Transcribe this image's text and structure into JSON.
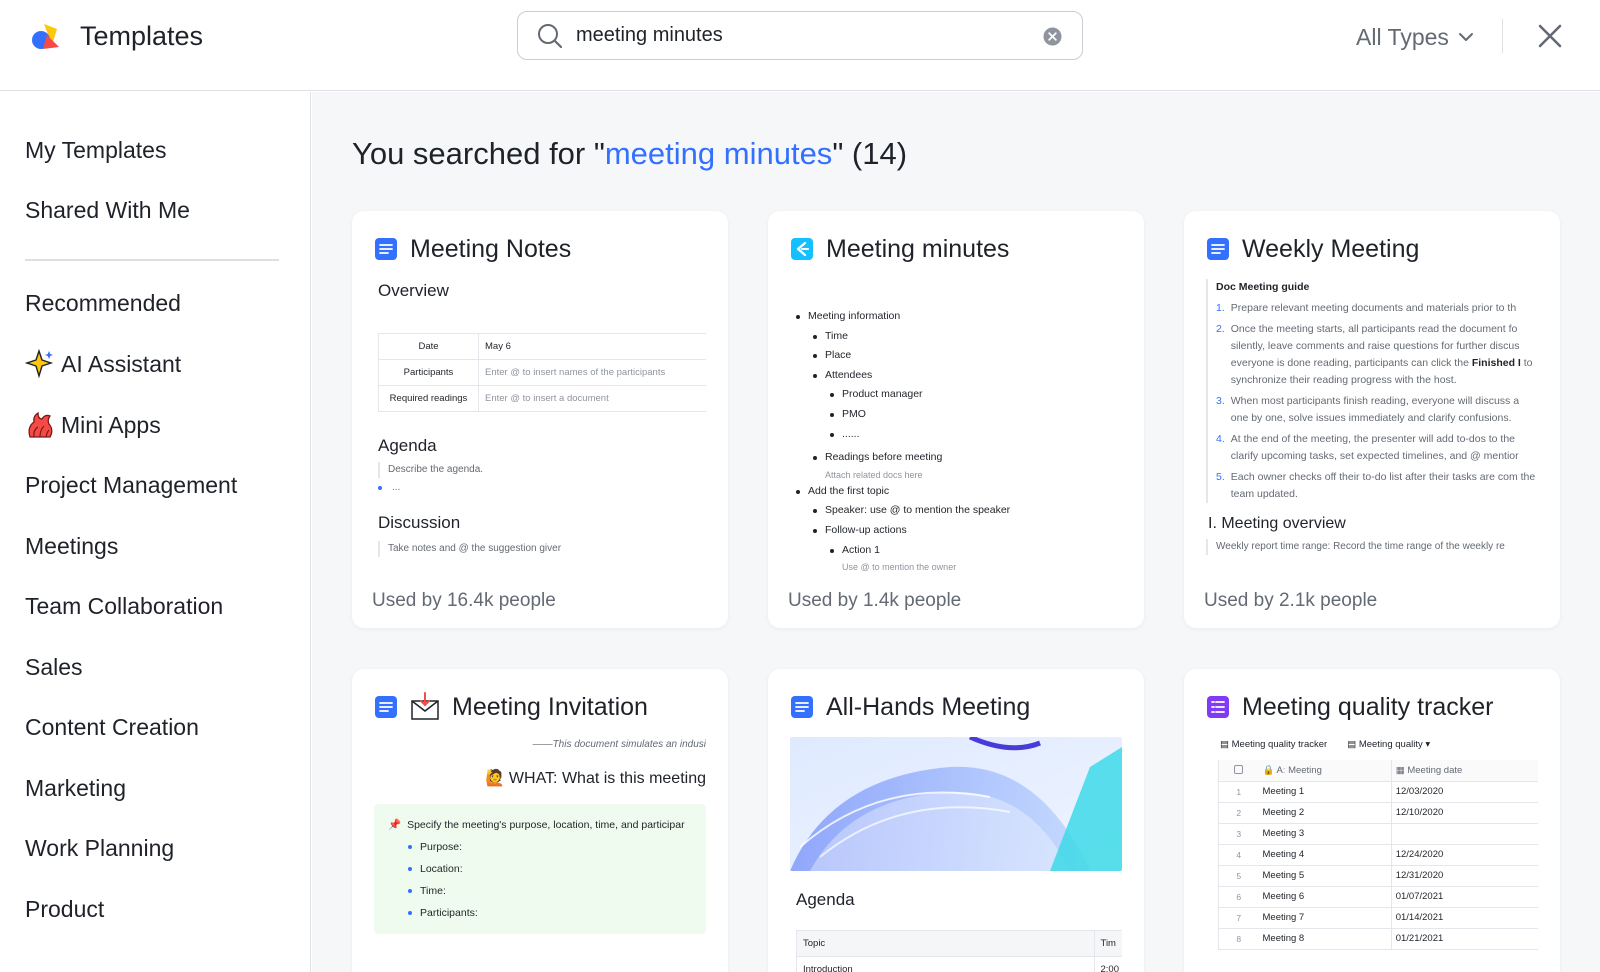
{
  "header": {
    "app_title": "Templates",
    "search": {
      "value": "meeting minutes",
      "placeholder": ""
    },
    "type_filter": "All Types"
  },
  "sidebar": {
    "top_items": [
      {
        "label": "My Templates"
      },
      {
        "label": "Shared With Me"
      }
    ],
    "categories": [
      {
        "label": "Recommended"
      },
      {
        "label": "AI Assistant",
        "icon": "sparkle-icon"
      },
      {
        "label": "Mini Apps",
        "icon": "mini-apps-icon"
      },
      {
        "label": "Project Management"
      },
      {
        "label": "Meetings"
      },
      {
        "label": "Team Collaboration"
      },
      {
        "label": "Sales"
      },
      {
        "label": "Content Creation"
      },
      {
        "label": "Marketing"
      },
      {
        "label": "Work Planning"
      },
      {
        "label": "Product"
      }
    ]
  },
  "main": {
    "result_prefix": "You searched for \"",
    "result_query": "meeting minutes",
    "result_suffix": "\" (14)",
    "cards": [
      {
        "title": "Meeting Notes",
        "icon": "doc-icon",
        "used": "Used by 16.4k people",
        "preview": {
          "h1": "Overview",
          "rows": [
            {
              "k": "Date",
              "v": "May 6"
            },
            {
              "k": "Participants",
              "v": "Enter @ to insert names of the participants"
            },
            {
              "k": "Required readings",
              "v": "Enter @ to insert a document"
            }
          ],
          "h2": "Agenda",
          "agenda_text": "Describe the agenda.",
          "agenda_bullet": "...",
          "h3": "Discussion",
          "discussion_text": "Take notes and @ the suggestion giver"
        }
      },
      {
        "title": "Meeting minutes",
        "icon": "minutes-icon",
        "used": "Used by 1.4k people",
        "preview": {
          "l1a": "Meeting information",
          "time": "Time",
          "place": "Place",
          "attendees": "Attendees",
          "pm": "Product manager",
          "pmo": "PMO",
          "dots": "......",
          "readings": "Readings before meeting",
          "attach": "Attach related docs here",
          "l1b": "Add the first topic",
          "speaker": "Speaker: use @ to mention the speaker",
          "followup": "Follow-up actions",
          "action": "Action 1",
          "owner": "Use @ to mention the owner"
        }
      },
      {
        "title": "Weekly Meeting",
        "icon": "doc-icon",
        "used": "Used by 2.1k people",
        "preview": {
          "guide_title": "Doc Meeting guide",
          "items": [
            {
              "n": "1.",
              "t": "Prepare relevant meeting documents and materials prior to th"
            },
            {
              "n": "2.",
              "t": "Once the meeting starts, all participants read the document fo silently, leave comments and raise questions for further discus everyone is done reading, participants can click the",
              "b": "Finished I",
              "t2": "to synchronize their reading progress with the host."
            },
            {
              "n": "3.",
              "t": "When most participants finish reading, everyone will discuss a one by one, solve issues immediately and clarify confusions."
            },
            {
              "n": "4.",
              "t": "At the end of the meeting, the presenter will add to-dos to the clarify upcoming tasks, set expected timelines, and @ mentior"
            },
            {
              "n": "5.",
              "t": "Each owner checks off their to-do list after their tasks are com the team updated."
            }
          ],
          "section": "I. Meeting overview",
          "section_text": "Weekly report time range: Record the time range of the weekly re"
        }
      },
      {
        "title": "Meeting Invitation",
        "icon": "doc-icon",
        "title_icon": "envelope-icon",
        "preview": {
          "quote": "——This document simulates an indusi",
          "what": "WHAT: What is this meeting",
          "specify": "Specify the meeting's purpose, location, time, and participar",
          "bullets": [
            "Purpose:",
            "Location:",
            "Time:",
            "Participants:"
          ]
        }
      },
      {
        "title": "All-Hands Meeting",
        "icon": "doc-icon",
        "preview": {
          "agenda": "Agenda",
          "col1": "Topic",
          "col2": "Tim",
          "row1": "Introduction",
          "row1b": "2:00"
        }
      },
      {
        "title": "Meeting quality tracker",
        "icon": "base-icon",
        "preview": {
          "view1": "Meeting quality tracker",
          "view2": "Meeting quality",
          "col_meeting": "Meeting",
          "col_date": "Meeting date",
          "rows": [
            {
              "n": "1",
              "m": "Meeting 1",
              "d": "12/03/2020"
            },
            {
              "n": "2",
              "m": "Meeting 2",
              "d": "12/10/2020"
            },
            {
              "n": "3",
              "m": "Meeting 3",
              "d": ""
            },
            {
              "n": "4",
              "m": "Meeting 4",
              "d": "12/24/2020"
            },
            {
              "n": "5",
              "m": "Meeting 5",
              "d": "12/31/2020"
            },
            {
              "n": "6",
              "m": "Meeting 6",
              "d": "01/07/2021"
            },
            {
              "n": "7",
              "m": "Meeting 7",
              "d": "01/14/2021"
            },
            {
              "n": "8",
              "m": "Meeting 8",
              "d": "01/21/2021"
            }
          ]
        }
      }
    ]
  },
  "colors": {
    "accent": "#3370ff",
    "text": "#1f2329",
    "muted": "#646a73",
    "border": "#dee0e3",
    "main_bg": "#f6f7f9"
  }
}
